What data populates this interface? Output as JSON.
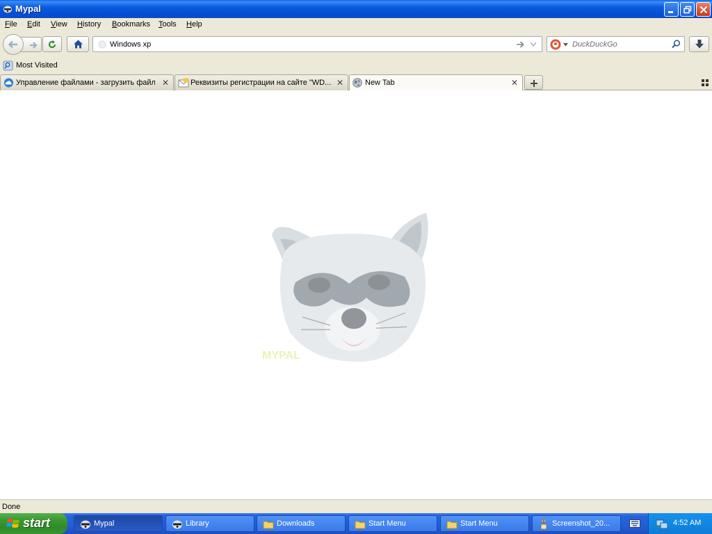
{
  "window": {
    "title": "Mypal"
  },
  "menu": {
    "items": [
      "File",
      "Edit",
      "View",
      "History",
      "Bookmarks",
      "Tools",
      "Help"
    ]
  },
  "navigation": {
    "url_value": "Windows xp",
    "search_placeholder": "DuckDuckGo",
    "search_engine_icon": "duckduckgo-icon"
  },
  "bookmarks": {
    "most_visited_label": "Most Visited"
  },
  "tabs": [
    {
      "label": "Управление файлами - загрузить файл",
      "active": false
    },
    {
      "label": "Реквизиты регистрации на сайте \"WD...",
      "active": false
    },
    {
      "label": "New Tab",
      "active": true
    }
  ],
  "content": {
    "logo_text": "MYPAL"
  },
  "status": {
    "text": "Done"
  },
  "taskbar": {
    "start_label": "start",
    "tasks": [
      {
        "label": "Mypal",
        "active": true,
        "icon": "raccoon-icon"
      },
      {
        "label": "Library",
        "active": false,
        "icon": "raccoon-icon"
      },
      {
        "label": "Downloads",
        "active": false,
        "icon": "folder-icon"
      },
      {
        "label": "Start Menu",
        "active": false,
        "icon": "folder-icon"
      },
      {
        "label": "Start Menu",
        "active": false,
        "icon": "folder-icon"
      },
      {
        "label": "Screenshot_20...",
        "active": false,
        "icon": "paintbrush-icon"
      }
    ],
    "clock": "4:52 AM"
  },
  "colors": {
    "titlebar": "#0a5bde",
    "chrome": "#ece9d8",
    "taskbar": "#245dd7",
    "start": "#3c9a34"
  }
}
